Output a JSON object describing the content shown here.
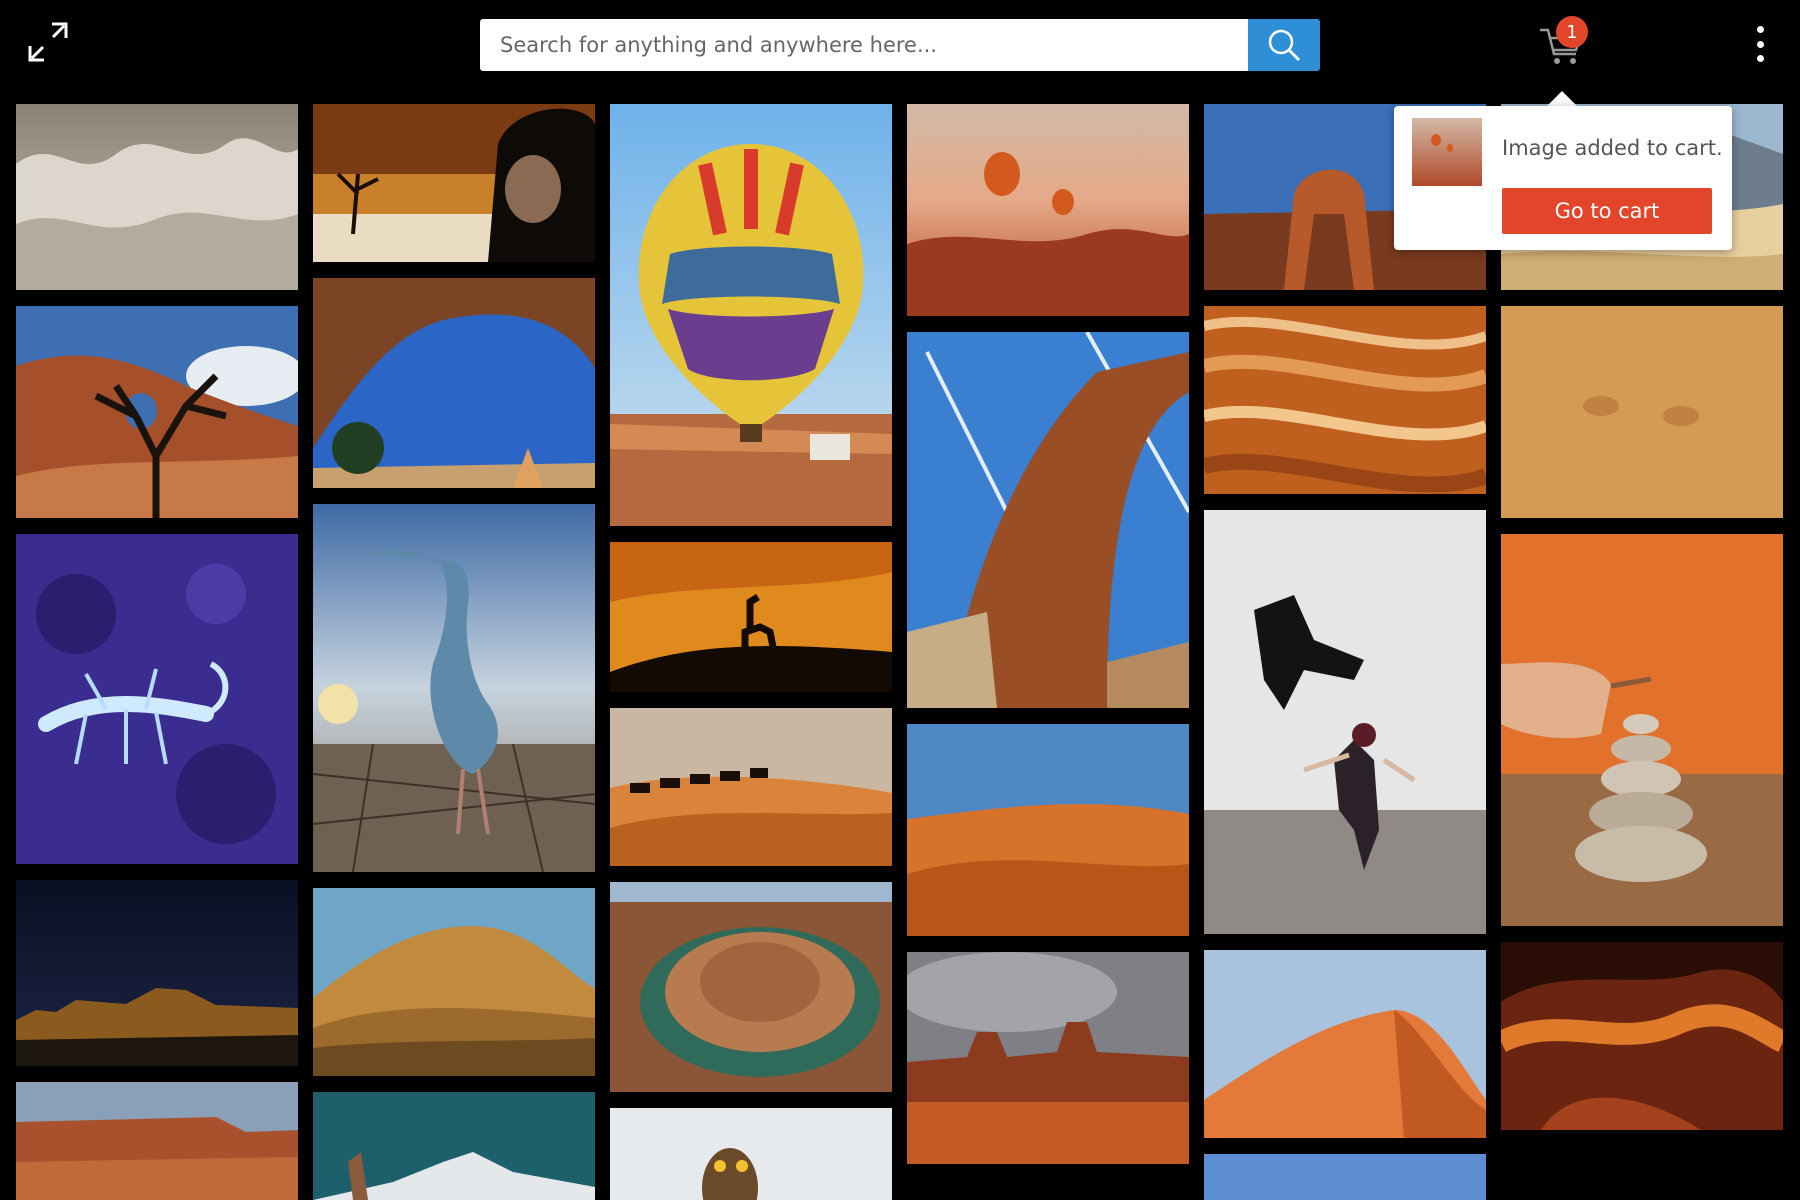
{
  "header": {
    "expand_icon": "expand-icon",
    "search": {
      "placeholder": "Search for anything and anywhere here...",
      "value": ""
    },
    "search_icon": "search-icon",
    "cart": {
      "icon": "cart-icon",
      "count": "1"
    },
    "menu_icon": "more-vertical-icon"
  },
  "cart_popover": {
    "message": "Image added to cart.",
    "button_label": "Go to cart"
  },
  "colors": {
    "background": "#000000",
    "accent": "#e2452a",
    "search_button": "#2e8fd6"
  },
  "gallery": [
    [
      "badlands hoodoos",
      "desert tree rock arch",
      "glowing scorpion",
      "night mesa under stars",
      "canyon cliffs"
    ],
    [
      "desert dead tree woman",
      "natural rock arch blue sky",
      "heron on cracked earth",
      "sand dunes",
      "rock pinnacle snowy mountain"
    ],
    [
      "hot air balloon",
      "camel silhouette sunset",
      "camel caravan dunes",
      "horseshoe bend",
      "burrowing owl"
    ],
    [
      "balloons over red desert",
      "rock arch contrails",
      "orange dunes",
      "monument valley storm"
    ],
    [
      "delicate arch",
      "the wave sandstone",
      "woman throwing scarf",
      "red dune hikers",
      "desert sky"
    ],
    [
      "bright dunes",
      "footprints in sand",
      "stacked stones cairn",
      "antelope canyon"
    ]
  ]
}
